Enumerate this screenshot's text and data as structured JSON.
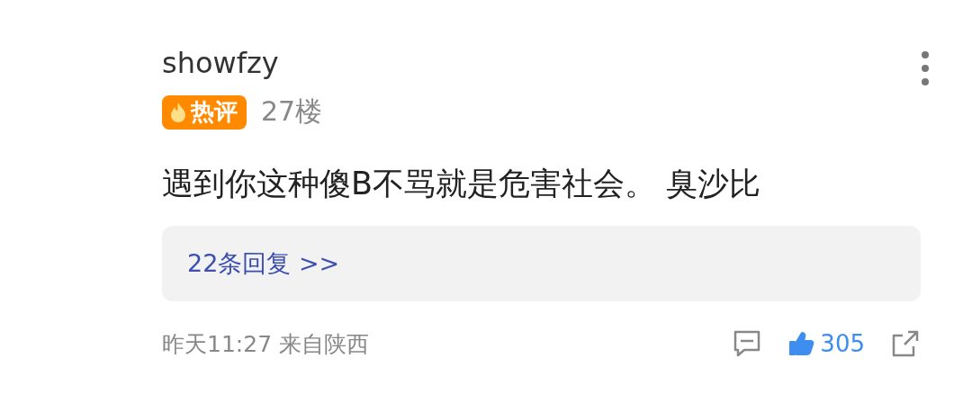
{
  "comment": {
    "username": "showfzy",
    "badge": "热评",
    "floor": "27楼",
    "text": "遇到你这种傻B不骂就是危害社会。 臭沙比",
    "replies_link": "22条回复 >>",
    "timestamp": "昨天11:27 来自陕西",
    "likes": "305",
    "liked": true
  }
}
